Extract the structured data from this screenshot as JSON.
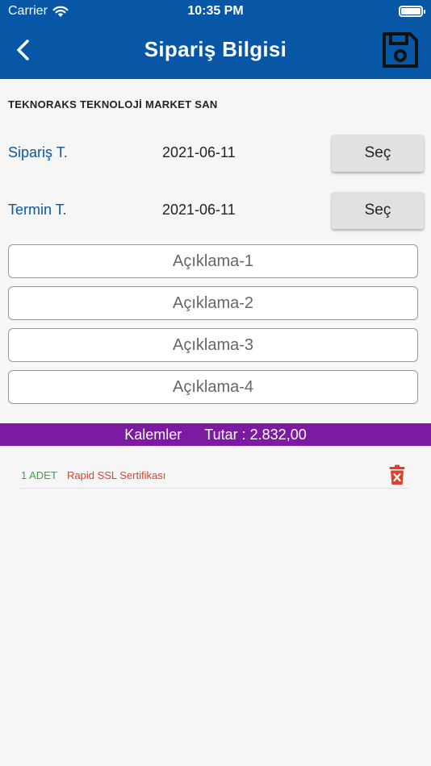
{
  "status": {
    "carrier": "Carrier",
    "time": "10:35 PM"
  },
  "header": {
    "title": "Sipariş Bilgisi",
    "back_icon": "chevron-left-icon",
    "save_icon": "floppy-disk-icon"
  },
  "company_name": "TEKNORAKS TEKNOLOJİ MARKET SAN",
  "order_date": {
    "label": "Sipariş T.",
    "value": "2021-06-11",
    "button_label": "Seç"
  },
  "due_date": {
    "label": "Termin T.",
    "value": "2021-06-11",
    "button_label": "Seç"
  },
  "descriptions": [
    {
      "placeholder": "Açıklama-1"
    },
    {
      "placeholder": "Açıklama-2"
    },
    {
      "placeholder": "Açıklama-3"
    },
    {
      "placeholder": "Açıklama-4"
    }
  ],
  "summary": {
    "items_label": "Kalemler",
    "total_label": "Tutar : 2.832,00"
  },
  "items": [
    {
      "quantity": "1 ADET",
      "name": "Rapid SSL Sertifikası"
    }
  ],
  "colors": {
    "header": "#0757a6",
    "summary_bar": "#7c1ba1",
    "label_blue": "#0a57a4",
    "quantity_green": "#3aa33f",
    "item_red": "#e0402b"
  }
}
